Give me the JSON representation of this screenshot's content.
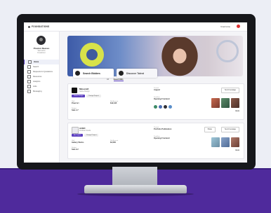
{
  "topbar": {
    "brand": "FOUNDATIONS",
    "user": "Username"
  },
  "profile": {
    "name": "Preston Reeves",
    "sub1": "Web Artist",
    "sub2": "Freelancer"
  },
  "sidebar": {
    "items": [
      {
        "label": "Home"
      },
      {
        "label": "Search"
      },
      {
        "label": "Requests for Quotations"
      },
      {
        "label": "Resources"
      },
      {
        "label": "Analytics"
      },
      {
        "label": "Jobs"
      },
      {
        "label": "Messaging"
      }
    ]
  },
  "tabs": [
    {
      "label": "Search Bidders"
    },
    {
      "label": "Discover Talent"
    }
  ],
  "subtabs": [
    "All",
    "Saved Bids"
  ],
  "cards": [
    {
      "name": "Minecraft",
      "meta": "Game Design",
      "pills": [
        "Game Design",
        "Design Project"
      ],
      "kv": [
        {
          "k": "Skill",
          "v": "Pixel Art"
        },
        {
          "k": "Bid Amount",
          "v": "$12,345"
        },
        {
          "k": "Budget",
          "v": "Sale 4.7"
        }
      ],
      "mid": [
        {
          "k": "Posted",
          "v": "August"
        },
        {
          "k": "Deadline",
          "v": "Opening Frontend"
        }
      ],
      "btn": "Send message",
      "more": "more"
    },
    {
      "name": "ArtBC",
      "meta": "Portfolio Studio",
      "pills": [
        "Art Project",
        "Design Project"
      ],
      "kv": [
        {
          "k": "Skill",
          "v": "Gallery Works"
        },
        {
          "k": "Bid Amount",
          "v": "$4,500"
        },
        {
          "k": "Budget",
          "v": "Sale 9.2"
        }
      ],
      "mid": [
        {
          "k": "Posted",
          "v": "Portfolio Publication"
        },
        {
          "k": "Deadline",
          "v": "Opening Frontend"
        }
      ],
      "btn": "Send message",
      "btn2": "Share",
      "more": "more"
    }
  ],
  "colors": {
    "accent": "#5a3dbf",
    "floor": "#4f2a9c",
    "hero_yellow": "#d8e24a"
  }
}
